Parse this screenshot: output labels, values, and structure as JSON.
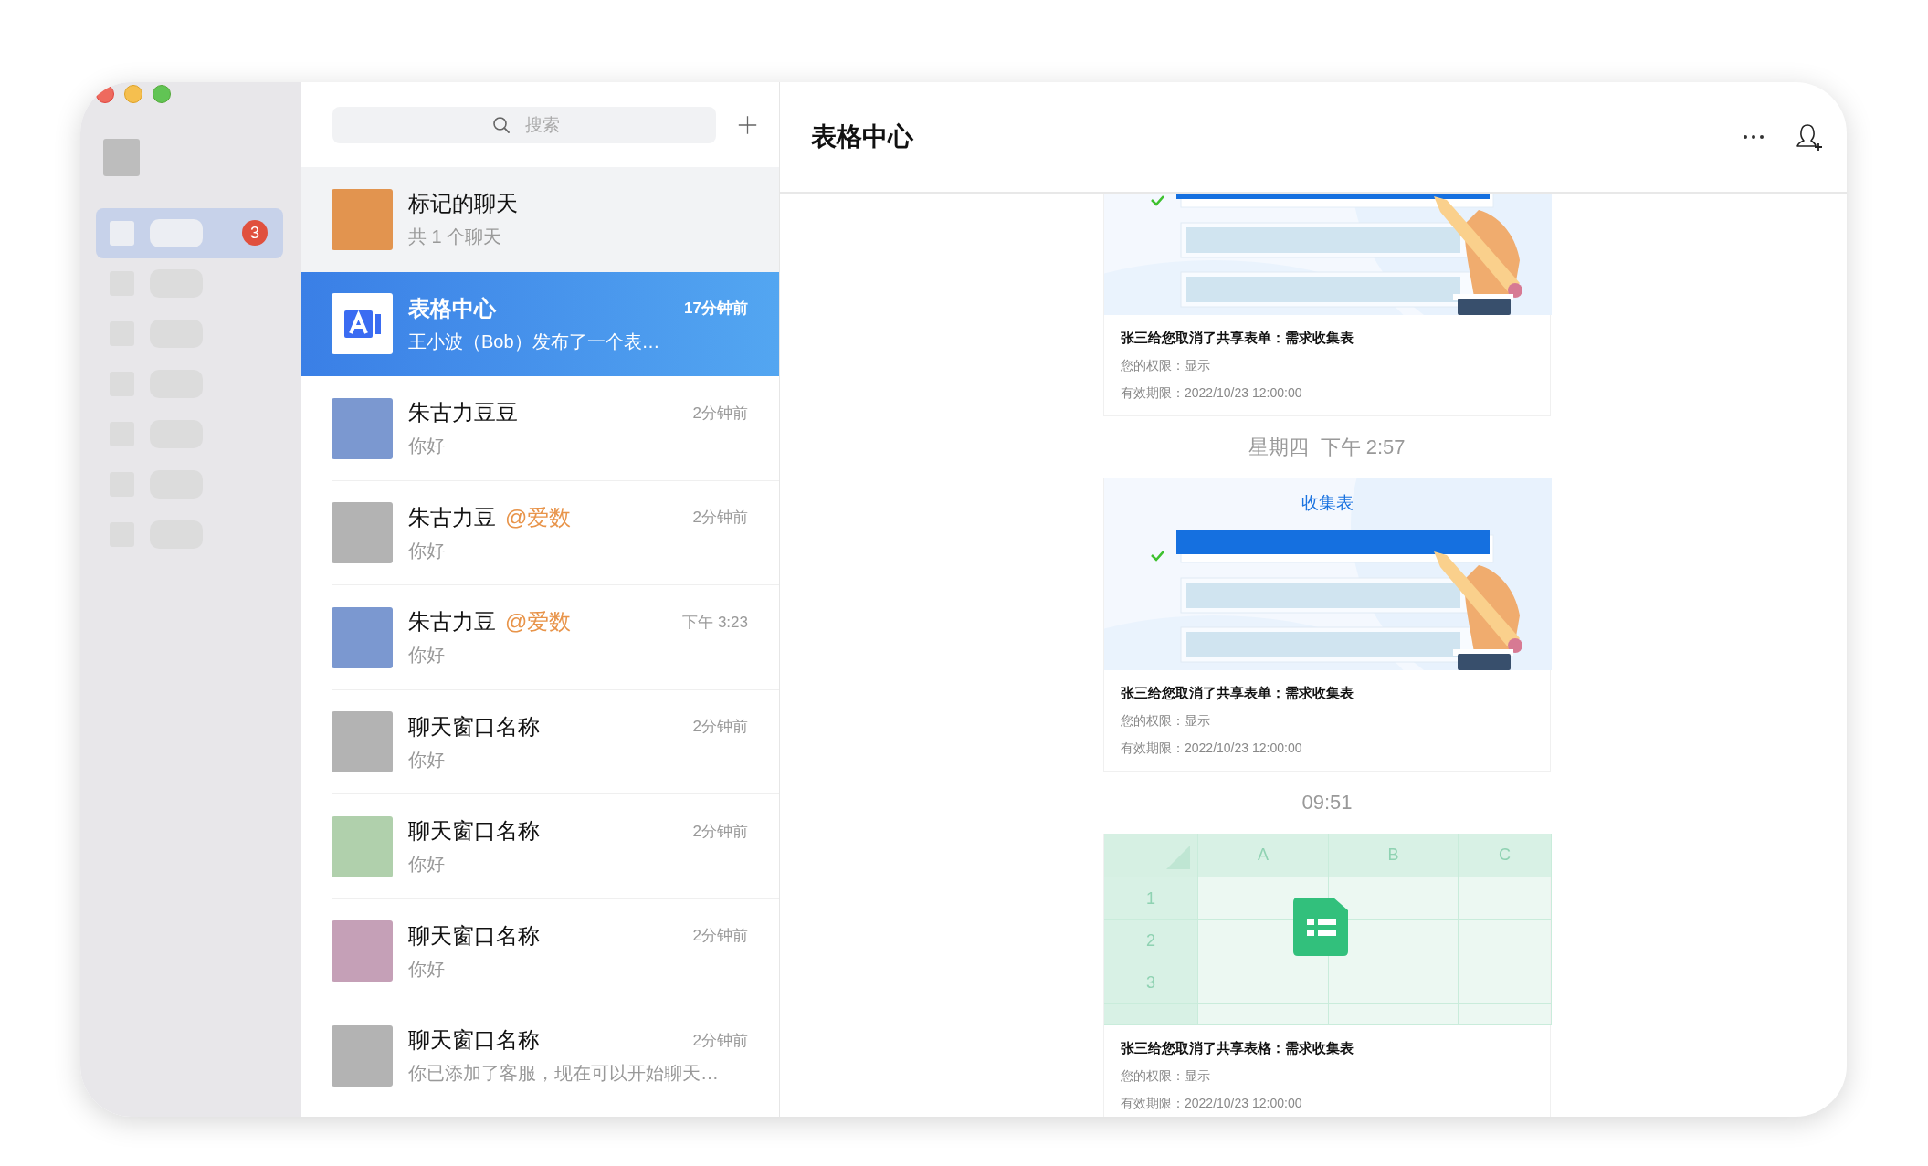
{
  "window": {
    "controls": [
      {
        "kind": "close",
        "color": "#ee6a5e"
      },
      {
        "kind": "minimize",
        "color": "#f5bf4f"
      },
      {
        "kind": "zoom",
        "color": "#61c454"
      }
    ]
  },
  "sidebar": {
    "items": [
      {
        "selected": true,
        "badge": "3"
      },
      {
        "selected": false
      },
      {
        "selected": false
      },
      {
        "selected": false
      },
      {
        "selected": false
      },
      {
        "selected": false
      },
      {
        "selected": false
      }
    ]
  },
  "search": {
    "placeholder": "搜索"
  },
  "chats": [
    {
      "kind": "folder",
      "name": "标记的聊天",
      "preview": "共 1 个聊天",
      "color": "#e2944f",
      "selected": false
    },
    {
      "kind": "app",
      "name": "表格中心",
      "time": "17分钟前",
      "preview": "王小波（Bob）发布了一个表…",
      "selected": true
    },
    {
      "kind": "person",
      "name": "朱古力豆豆",
      "time": "2分钟前",
      "preview": "你好",
      "color": "#7b98d0",
      "selected": false
    },
    {
      "kind": "person",
      "name": "朱古力豆",
      "mention": "@爱数",
      "time": "2分钟前",
      "preview": "你好",
      "color": "#b3b3b3",
      "selected": false
    },
    {
      "kind": "person",
      "name": "朱古力豆",
      "mention": "@爱数",
      "time": "下午 3:23",
      "preview": "你好",
      "color": "#7b98d0",
      "selected": false
    },
    {
      "kind": "person",
      "name": "聊天窗口名称",
      "time": "2分钟前",
      "preview": "你好",
      "color": "#b3b3b3",
      "selected": false
    },
    {
      "kind": "person",
      "name": "聊天窗口名称",
      "time": "2分钟前",
      "preview": "你好",
      "color": "#b0d0ac",
      "selected": false
    },
    {
      "kind": "person",
      "name": "聊天窗口名称",
      "time": "2分钟前",
      "preview": "你好",
      "color": "#c5a0b7",
      "selected": false
    },
    {
      "kind": "person",
      "name": "聊天窗口名称",
      "time": "2分钟前",
      "preview": "你已添加了客服，现在可以开始聊天…",
      "color": "#b3b3b3",
      "selected": false
    }
  ],
  "conversation": {
    "title": "表格中心",
    "messages": [
      {
        "kind": "form_card",
        "clipped": true,
        "headline": "张三给您取消了共享表单：需求收集表",
        "permission": "您的权限：显示",
        "expiry": "有效期限：2022/10/23 12:00:00"
      },
      {
        "kind": "time",
        "text": "星期四  下午 2:57"
      },
      {
        "kind": "form_card",
        "clipped": false,
        "heading": "收集表",
        "headline": "张三给您取消了共享表单：需求收集表",
        "permission": "您的权限：显示",
        "expiry": "有效期限：2022/10/23 12:00:00"
      },
      {
        "kind": "time",
        "text": "09:51"
      },
      {
        "kind": "sheet_card",
        "columns": [
          "A",
          "B",
          "C"
        ],
        "rows": [
          "1",
          "2",
          "3"
        ],
        "headline": "张三给您取消了共享表格：需求收集表",
        "permission": "您的权限：显示",
        "expiry": "有效期限：2022/10/23 12:00:00"
      }
    ]
  }
}
